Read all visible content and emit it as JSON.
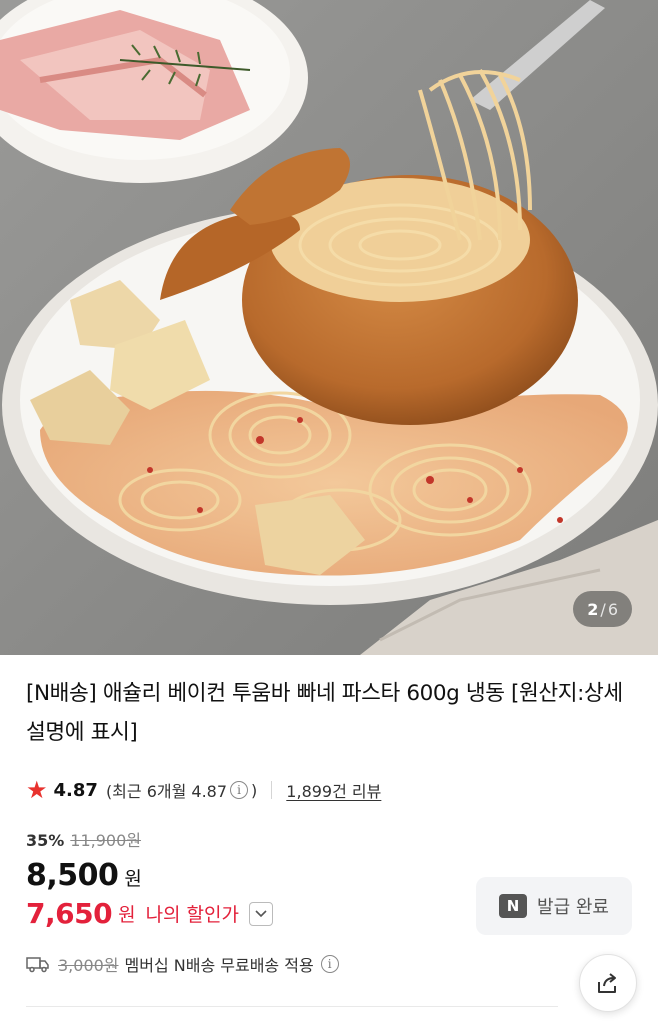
{
  "gallery": {
    "current": "2",
    "separator": "/",
    "total": "6"
  },
  "product": {
    "title": "[N배송] 애슐리 베이컨 투움바 빠네 파스타 600g 냉동 [원산지:상세설명에 표시]"
  },
  "rating": {
    "score": "4.87",
    "recent_label": "(최근 6개월 4.87",
    "recent_close": ")",
    "info_glyph": "i",
    "reviews": "1,899건 리뷰"
  },
  "pricing": {
    "discount_rate": "35%",
    "original_price": "11,900원",
    "price": "8,500",
    "currency": "원",
    "member_price": "7,650",
    "member_currency": "원",
    "member_label": "나의 할인가"
  },
  "coupon": {
    "badge": "N",
    "label": "발급 완료"
  },
  "shipping": {
    "fee": "3,000원",
    "text": "멤버십 N배송 무료배송 적용"
  },
  "icons": {
    "rating": "star-icon",
    "info": "info-icon",
    "chevron": "chevron-down-icon",
    "truck": "truck-icon",
    "share": "share-icon"
  },
  "colors": {
    "accent_red": "#e3213b",
    "star_red": "#e8322e",
    "coupon_bg": "#f3f4f6"
  }
}
